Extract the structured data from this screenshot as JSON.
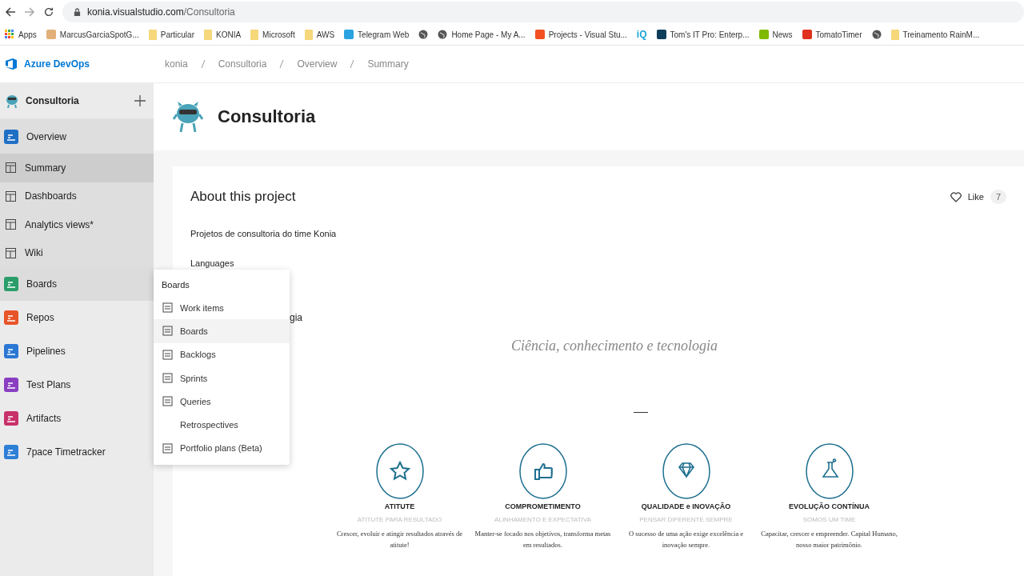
{
  "browser": {
    "url_host": "konia.visualstudio.com",
    "url_path": "/Consultoria",
    "bookmarks": [
      {
        "label": "Apps",
        "kind": "apps"
      },
      {
        "label": "MarcusGarciaSpotG...",
        "kind": "site"
      },
      {
        "label": "Particular",
        "kind": "folder"
      },
      {
        "label": "KONIA",
        "kind": "folder"
      },
      {
        "label": "Microsoft",
        "kind": "folder"
      },
      {
        "label": "AWS",
        "kind": "folder"
      },
      {
        "label": "Telegram Web",
        "kind": "site"
      },
      {
        "kind": "globe"
      },
      {
        "label": "Home Page - My A...",
        "kind": "globe"
      },
      {
        "label": "Projects - Visual Stu...",
        "kind": "site"
      },
      {
        "label": "iQ",
        "kind": "text"
      },
      {
        "label": "Tom's IT Pro: Enterp...",
        "kind": "site"
      },
      {
        "label": "News",
        "kind": "site"
      },
      {
        "label": "TomatoTimer",
        "kind": "site"
      },
      {
        "kind": "globe"
      },
      {
        "label": "Treinamento RainM...",
        "kind": "folder"
      }
    ]
  },
  "header": {
    "brand": "Azure DevOps",
    "breadcrumb": [
      "konia",
      "Consultoria",
      "Overview",
      "Summary"
    ]
  },
  "sidebar": {
    "project": "Consultoria",
    "items": [
      {
        "label": "Overview",
        "kind": "hub",
        "expanded": true,
        "flyout_open": false,
        "children": [
          {
            "label": "Summary",
            "selected": true
          },
          {
            "label": "Dashboards",
            "selected": false
          },
          {
            "label": "Analytics views*",
            "selected": false
          },
          {
            "label": "Wiki",
            "selected": false
          }
        ]
      },
      {
        "label": "Boards",
        "kind": "hub",
        "expanded": false,
        "flyout_open": true
      },
      {
        "label": "Repos",
        "kind": "hub",
        "expanded": false,
        "flyout_open": false
      },
      {
        "label": "Pipelines",
        "kind": "hub",
        "expanded": false,
        "flyout_open": false
      },
      {
        "label": "Test Plans",
        "kind": "hub",
        "expanded": false,
        "flyout_open": false
      },
      {
        "label": "Artifacts",
        "kind": "hub",
        "expanded": false,
        "flyout_open": false
      },
      {
        "label": "7pace Timetracker",
        "kind": "hub",
        "expanded": false,
        "flyout_open": false
      }
    ]
  },
  "flyout": {
    "title": "Boards",
    "items": [
      {
        "label": "Work items",
        "selected": false
      },
      {
        "label": "Boards",
        "selected": true
      },
      {
        "label": "Backlogs",
        "selected": false
      },
      {
        "label": "Sprints",
        "selected": false
      },
      {
        "label": "Queries",
        "selected": false
      },
      {
        "label": "Retrospectives",
        "selected": false
      },
      {
        "label": "Portfolio plans (Beta)",
        "selected": false
      }
    ]
  },
  "project": {
    "title": "Consultoria"
  },
  "about": {
    "heading": "About this project",
    "like_label": "Like",
    "like_count": "7",
    "description": "Projetos de consultoria do time Konia",
    "languages_label": "Languages",
    "fragment": "gia",
    "tagline": "Ciência, conhecimento e tecnologia"
  },
  "values": [
    {
      "title": "ATITUTE",
      "subtitle": "ATITUTE PARA RESULTADO",
      "text": "Crescer, evoluir e atingir resultados através de atitute!"
    },
    {
      "title": "COMPROMETIMENTO",
      "subtitle": "ALINHAMENTO E EXPECTATIVA",
      "text": "Manter-se focado nos objetivos, transforma metas em resultados."
    },
    {
      "title": "QUALIDADE e INOVAÇÃO",
      "subtitle": "PENSAR DIFERENTE SEMPRE",
      "text": "O sucesso de uma ação exige excelência e inovação sempre."
    },
    {
      "title": "EVOLUÇÃO CONTÍNUA",
      "subtitle": "SOMOS UM TIME",
      "text": "Capacitar, crescer e empreender. Capital Humano, nosso maior patrimônio."
    }
  ]
}
